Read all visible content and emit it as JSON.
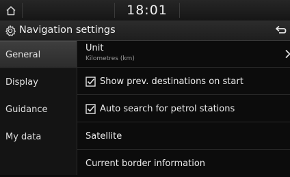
{
  "status_bar": {
    "time": "18:01"
  },
  "header": {
    "title": "Navigation settings"
  },
  "sidebar": {
    "items": [
      {
        "label": "General",
        "active": true
      },
      {
        "label": "Display",
        "active": false
      },
      {
        "label": "Guidance",
        "active": false
      },
      {
        "label": "My data",
        "active": false
      }
    ]
  },
  "settings": {
    "unit": {
      "label": "Unit",
      "value": "Kilometres (km)"
    },
    "show_prev_destinations": {
      "label": "Show prev. destinations on start",
      "checked": true
    },
    "auto_search_petrol": {
      "label": "Auto search for petrol stations",
      "checked": true
    },
    "satellite": {
      "label": "Satellite"
    },
    "border_info": {
      "label": "Current border information"
    }
  },
  "colors": {
    "background": "#0c0c0c",
    "text": "#e8e8e8",
    "active_tab": "#3a3a3a"
  },
  "icons": [
    "home-icon",
    "gear-icon",
    "back-icon",
    "checkbox-icon",
    "chevron-right-icon"
  ]
}
